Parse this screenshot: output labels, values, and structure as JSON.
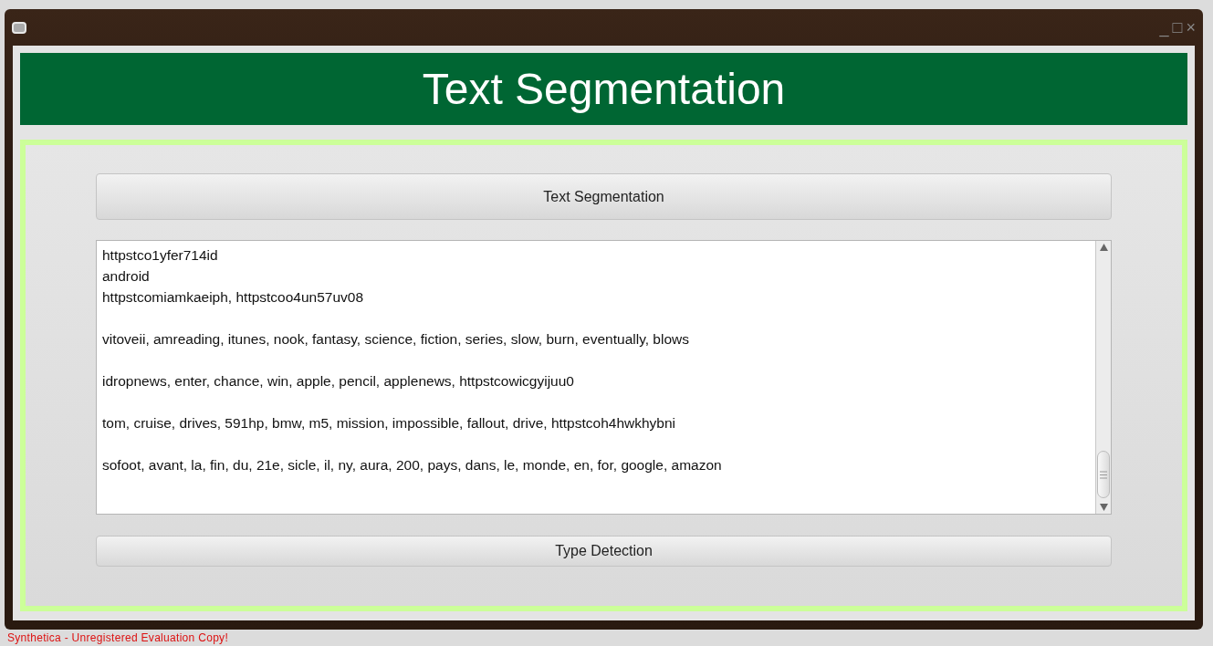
{
  "window": {
    "title_bar_buttons": [
      "_",
      "□",
      "×"
    ]
  },
  "header": {
    "title": "Text Segmentation"
  },
  "segment_button": {
    "label": "Text Segmentation"
  },
  "output": {
    "value": "httpstco1yfer714id\nandroid\nhttpstcomiamkaeiph, httpstcoo4un57uv08\n\nvitoveii, amreading, itunes, nook, fantasy, science, fiction, series, slow, burn, eventually, blows\n\nidropnews, enter, chance, win, apple, pencil, applenews, httpstcowicgyijuu0\n\ntom, cruise, drives, 591hp, bmw, m5, mission, impossible, fallout, drive, httpstcoh4hwkhybni\n\nsofoot, avant, la, fin, du, 21e, sicle, il, ny, aura, 200, pays, dans, le, monde, en, for, google, amazon"
  },
  "detect_button": {
    "label": "Type Detection"
  },
  "footer": {
    "notice": "Synthetica - Unregistered Evaluation Copy!"
  }
}
